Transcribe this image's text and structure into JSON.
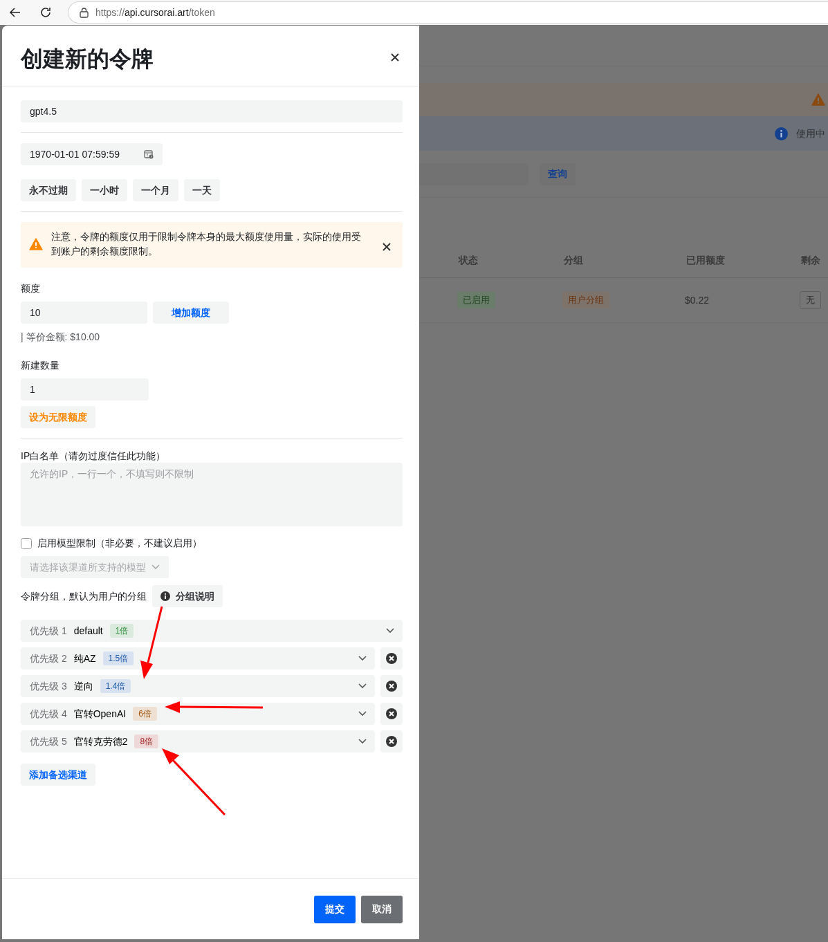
{
  "browser": {
    "url_scheme": "https://",
    "url_host": "api.cursorai.art",
    "url_path": "/token"
  },
  "background_page": {
    "info_banner": {
      "text": "使用中"
    },
    "query_button": "查询",
    "table": {
      "columns": [
        "状态",
        "分组",
        "已用额度",
        "剩余"
      ],
      "rows": [
        {
          "cells": [
            {
              "kind": "status",
              "text": "已启用"
            },
            {
              "kind": "group",
              "text": "用户分组"
            },
            {
              "kind": "plain",
              "text": "$0.22"
            },
            {
              "kind": "outline",
              "text": "无"
            }
          ]
        }
      ]
    }
  },
  "sheet": {
    "title": "创建新的令牌",
    "name_field": {
      "value": "gpt4.5"
    },
    "expiry_field": {
      "value": "1970-01-01 07:59:59"
    },
    "expiry_presets": [
      "永不过期",
      "一小时",
      "一个月",
      "一天"
    ],
    "alert": {
      "text": "注意，令牌的额度仅用于限制令牌本身的最大额度使用量，实际的使用受到账户的剩余额度限制。"
    },
    "quota": {
      "label": "额度",
      "value": "10",
      "add_button": "增加额度",
      "equivalent": "| 等价金额: $10.00"
    },
    "count": {
      "label": "新建数量",
      "value": "1"
    },
    "unlimited_button": "设为无限额度",
    "ip_whitelist": {
      "label": "IP白名单（请勿过度信任此功能）",
      "placeholder": "允许的IP，一行一个，不填写则不限制"
    },
    "model_limit": {
      "label": "启用模型限制（非必要，不建议启用）",
      "checked": false
    },
    "model_select": {
      "placeholder": "请选择该渠道所支持的模型"
    },
    "group": {
      "label": "令牌分组，默认为用户的分组",
      "help_button": "分组说明"
    },
    "priorities": [
      {
        "label": "优先级 1",
        "name": "default",
        "rate": "1倍",
        "color": "#2f8a3c",
        "removable": false
      },
      {
        "label": "优先级 2",
        "name": "纯AZ",
        "rate": "1.5倍",
        "color": "#1f5aa8",
        "removable": true
      },
      {
        "label": "优先级 3",
        "name": "逆向",
        "rate": "1.4倍",
        "color": "#1f5aa8",
        "removable": true
      },
      {
        "label": "优先级 4",
        "name": "官转OpenAI",
        "rate": "6倍",
        "color": "#a0560e",
        "removable": true
      },
      {
        "label": "优先级 5",
        "name": "官转克劳德2",
        "rate": "8倍",
        "color": "#a32424",
        "removable": true
      }
    ],
    "add_channel_button": "添加备选渠道",
    "footer": {
      "submit": "提交",
      "cancel": "取消"
    }
  }
}
